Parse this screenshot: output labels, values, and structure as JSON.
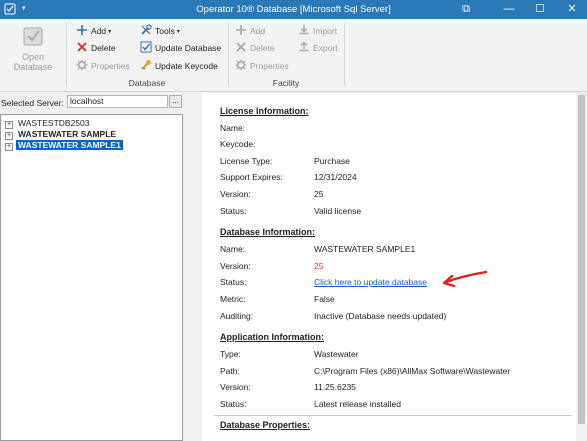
{
  "window": {
    "title": "Operator 10® Database [Microsoft Sql Server]",
    "qa_caret": "▾",
    "restore_glyph": "⧉",
    "minimize_glyph": "—",
    "maximize_glyph": "☐",
    "close_glyph": "✕"
  },
  "ribbon": {
    "open_database": "Open Database",
    "database_group": {
      "label": "Database",
      "add": "Add",
      "delete": "Delete",
      "properties": "Properties",
      "tools": "Tools",
      "update_database": "Update Database",
      "update_keycode": "Update Keycode",
      "caret": "▾"
    },
    "facility_group": {
      "label": "Facility",
      "add": "Add",
      "delete": "Delete",
      "properties": "Properties",
      "import": "Import",
      "export": "Export"
    }
  },
  "left": {
    "server_label": "Selected Server:",
    "server_value": "localhost",
    "browse_label": "...",
    "tree": [
      {
        "label": "WASTESTDB2503"
      },
      {
        "label": "WASTEWATER SAMPLE"
      },
      {
        "label": "WASTEWATER SAMPLE1"
      }
    ],
    "expander": "+"
  },
  "license": {
    "title": "License Information:",
    "name_label": "Name:",
    "name_value": "",
    "keycode_label": "Keycode:",
    "keycode_value": "",
    "type_label": "License Type:",
    "type_value": "Purchase",
    "expires_label": "Support Expires:",
    "expires_value": "12/31/2024",
    "version_label": "Version:",
    "version_value": "25",
    "status_label": "Status:",
    "status_value": "Valid license"
  },
  "database": {
    "title": "Database Information:",
    "name_label": "Name:",
    "name_value": "WASTEWATER SAMPLE1",
    "version_label": "Version:",
    "version_value": "25",
    "status_label": "Status:",
    "status_link": "Click here to update database",
    "metric_label": "Metric:",
    "metric_value": "False",
    "auditing_label": "Auditing:",
    "auditing_value": "Inactive (Database needs updated)"
  },
  "application": {
    "title": "Application Information:",
    "type_label": "Type:",
    "type_value": "Wastewater",
    "path_label": "Path:",
    "path_value": "C:\\Program Files (x86)\\AllMax Software\\Wastewater",
    "version_label": "Version:",
    "version_value": "11.25.6235",
    "status_label": "Status:",
    "status_value": "Latest release installed"
  },
  "properties": {
    "title": "Database Properties:"
  },
  "colors": {
    "titlebar": "#2b78b7",
    "selection": "#0a64c8",
    "link": "#1a5bd6",
    "warning_text": "#d23c1e",
    "annotation_arrow": "#e02020"
  }
}
